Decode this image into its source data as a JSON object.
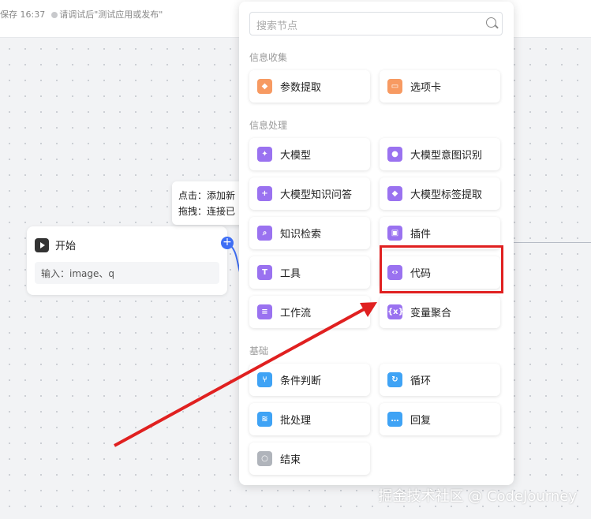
{
  "topbar": {
    "save_text": "保存 16:37",
    "hint": "请调试后\"测试应用或发布\""
  },
  "start_node": {
    "title": "开始",
    "input": "输入：image、q"
  },
  "tooltip": {
    "line1": "点击：添加新",
    "line2": "拖拽：连接已"
  },
  "panel": {
    "search_placeholder": "搜索节点",
    "sections": [
      {
        "title": "信息收集",
        "items": [
          {
            "label": "参数提取",
            "icon": "param-extract-icon",
            "color": "#f79a62"
          },
          {
            "label": "选项卡",
            "icon": "card-icon",
            "color": "#f79a62"
          }
        ]
      },
      {
        "title": "信息处理",
        "items": [
          {
            "label": "大模型",
            "icon": "sparkle-icon",
            "color": "#9a72f0"
          },
          {
            "label": "大模型意图识别",
            "icon": "robot-icon",
            "color": "#9a72f0"
          },
          {
            "label": "大模型知识问答",
            "icon": "chat-plus-icon",
            "color": "#9a72f0"
          },
          {
            "label": "大模型标签提取",
            "icon": "tag-icon",
            "color": "#9a72f0"
          },
          {
            "label": "知识检索",
            "icon": "search-icon",
            "color": "#9a72f0"
          },
          {
            "label": "插件",
            "icon": "cube-icon",
            "color": "#9a72f0"
          },
          {
            "label": "工具",
            "icon": "tool-icon",
            "color": "#9a72f0"
          },
          {
            "label": "代码",
            "icon": "code-icon",
            "color": "#9a72f0"
          },
          {
            "label": "工作流",
            "icon": "workflow-icon",
            "color": "#9a72f0"
          },
          {
            "label": "变量聚合",
            "icon": "variable-icon",
            "color": "#9a72f0"
          }
        ]
      },
      {
        "title": "基础",
        "items": [
          {
            "label": "条件判断",
            "icon": "branch-icon",
            "color": "#3fa3f5"
          },
          {
            "label": "循环",
            "icon": "loop-icon",
            "color": "#3fa3f5"
          },
          {
            "label": "批处理",
            "icon": "layers-icon",
            "color": "#3fa3f5"
          },
          {
            "label": "回复",
            "icon": "reply-icon",
            "color": "#3fa3f5"
          },
          {
            "label": "结束",
            "icon": "end-icon",
            "color": "#b0b4bb"
          }
        ]
      }
    ]
  },
  "watermark": "掘金技术社区 @ CodeJourney"
}
